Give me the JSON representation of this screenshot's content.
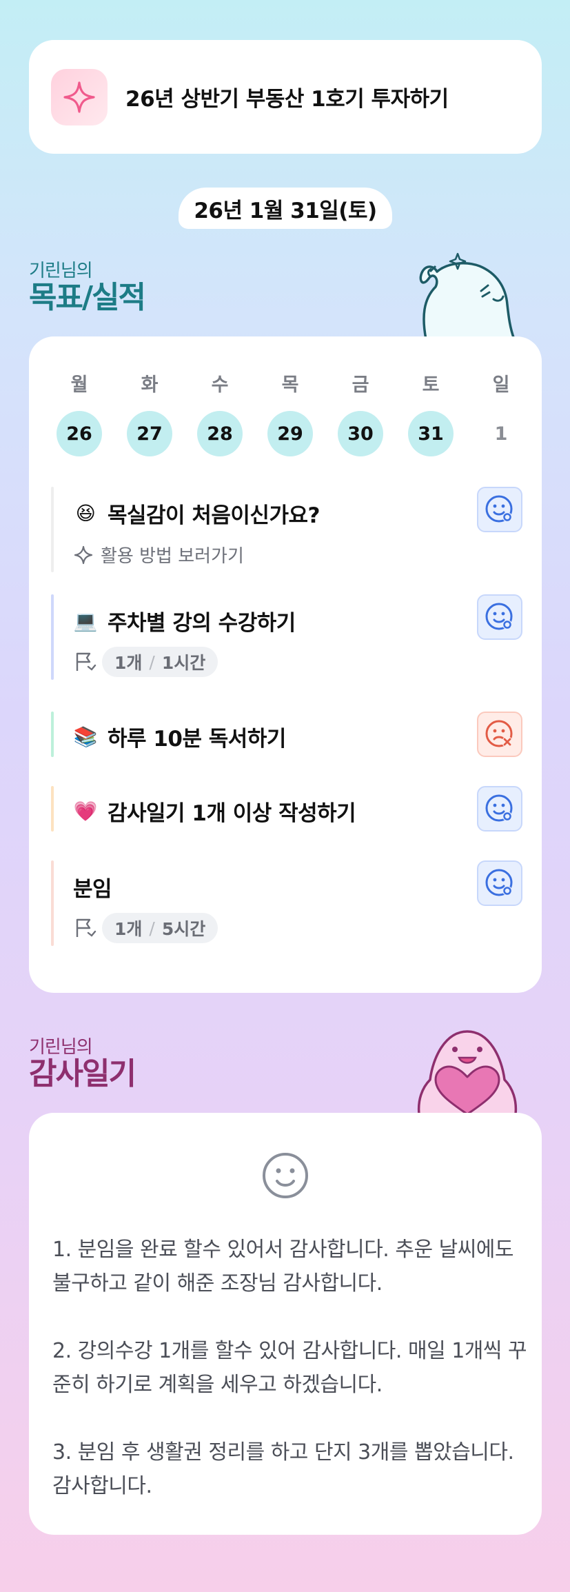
{
  "goal": {
    "title": "26년 상반기 부동산 1호기 투자하기",
    "icon": "sparkle-icon"
  },
  "date": "26년 1월 31일(토)",
  "goal_section": {
    "small": "기린님의",
    "big": "목표/실적"
  },
  "week": {
    "weekdays": [
      "월",
      "화",
      "수",
      "목",
      "금",
      "토",
      "일"
    ],
    "days": [
      "26",
      "27",
      "28",
      "29",
      "30",
      "31",
      "1"
    ]
  },
  "items": [
    {
      "emoji": "😆",
      "title": "목실감이 처음이신가요?",
      "link": "활용 방법 보러가기",
      "bar_color": "#eeeeee",
      "status": "done"
    },
    {
      "emoji": "💻",
      "title": "주차별 강의 수강하기",
      "progress": {
        "count": "1개",
        "time": "1시간"
      },
      "bar_color": "#cfd8fb",
      "status": "done"
    },
    {
      "emoji": "📚",
      "title": "하루 10분 독서하기",
      "bar_color": "#bdf0da",
      "status": "missed"
    },
    {
      "emoji": "💗",
      "title": "감사일기 1개 이상 작성하기",
      "bar_color": "#fde2c0",
      "status": "done"
    },
    {
      "emoji": "",
      "title": "분임",
      "progress": {
        "count": "1개",
        "time": "5시간"
      },
      "bar_color": "#fadcd5",
      "status": "done"
    }
  ],
  "diary_section": {
    "small": "기린님의",
    "big": "감사일기"
  },
  "diary": {
    "entries": [
      "1. 분임을 완료 할수 있어서 감사합니다. 추운 날씨에도 불구하고 같이 해준 조장님 감사합니다.",
      "2. 강의수강 1개를 할수 있어 감사합니다. 매일 1개씩 꾸준히 하기로 계획을 세우고 하겠습니다.",
      "3. 분임 후 생활권 정리를 하고 단지 3개를 뽑았습니다. 감사합니다."
    ]
  },
  "colors": {
    "accent_teal": "#1d7c86",
    "accent_plum": "#8e2f6e",
    "day_bubble": "#c2eef0",
    "status_ok": "#3a6fe0",
    "status_missed": "#e25b45"
  }
}
